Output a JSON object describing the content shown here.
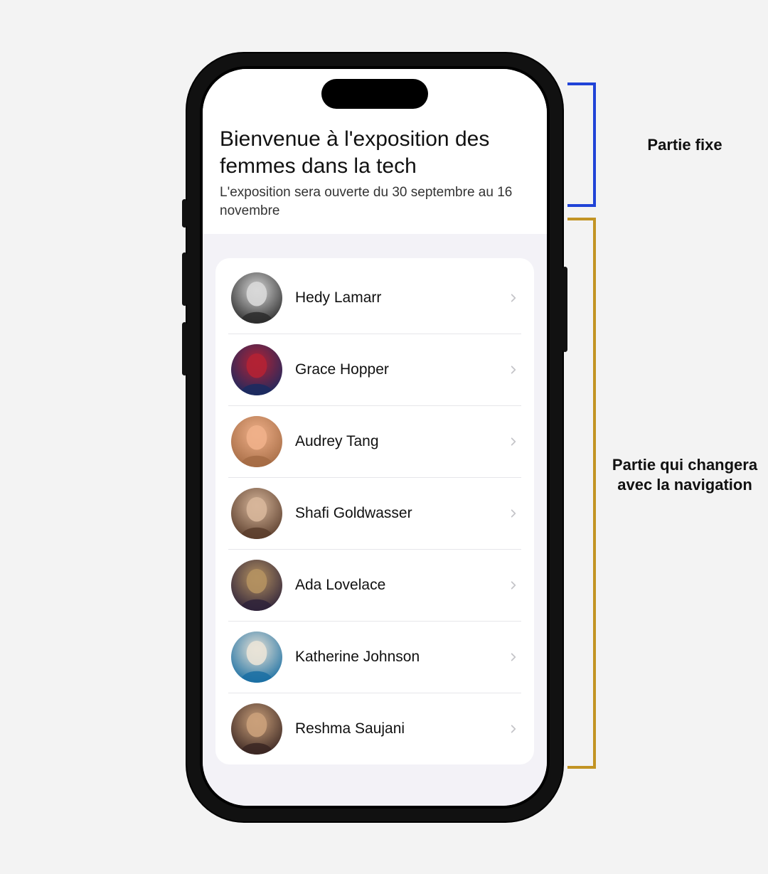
{
  "header": {
    "title": "Bienvenue à l'exposition des femmes dans la tech",
    "subtitle": "L'exposition sera ouverte du 30 septembre au 16 novembre"
  },
  "list": {
    "items": [
      {
        "name": "Hedy Lamarr",
        "avatar_colors": [
          "#2b2b2b",
          "#d8d8d8"
        ]
      },
      {
        "name": "Grace Hopper",
        "avatar_colors": [
          "#1a2a60",
          "#b22234"
        ]
      },
      {
        "name": "Audrey Tang",
        "avatar_colors": [
          "#a56b44",
          "#efb089"
        ]
      },
      {
        "name": "Shafi Goldwasser",
        "avatar_colors": [
          "#5a3d2c",
          "#d7b69a"
        ]
      },
      {
        "name": "Ada Lovelace",
        "avatar_colors": [
          "#2e223a",
          "#b49160"
        ]
      },
      {
        "name": "Katherine Johnson",
        "avatar_colors": [
          "#1a6fa3",
          "#e9e3d7"
        ]
      },
      {
        "name": "Reshma Saujani",
        "avatar_colors": [
          "#3a2622",
          "#caa07a"
        ]
      }
    ]
  },
  "annotations": {
    "fixed_label": "Partie fixe",
    "navigable_label": "Partie qui changera avec la navigation"
  }
}
